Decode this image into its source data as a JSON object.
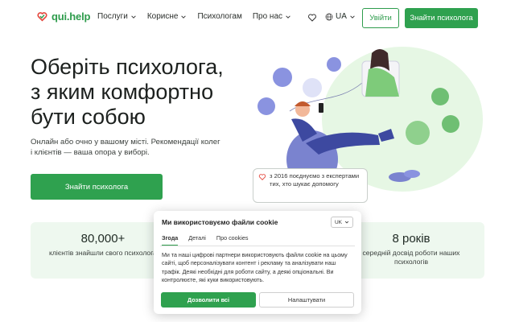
{
  "header": {
    "logo_text": "qui.help",
    "nav": [
      {
        "label": "Послуги",
        "has_dropdown": true
      },
      {
        "label": "Корисне",
        "has_dropdown": true
      },
      {
        "label": "Психологам",
        "has_dropdown": false
      },
      {
        "label": "Про нас",
        "has_dropdown": true
      }
    ],
    "language": "UA",
    "login_label": "Увійти",
    "find_label": "Знайти психолога"
  },
  "hero": {
    "title_lines": [
      "Оберіть психолога,",
      "з яким комфортно",
      "бути собою"
    ],
    "subtitle": "Онлайн або очно у вашому місті. Рекомендації колег і клієнтів — ваша опора у виборі.",
    "cta_label": "Знайти психолога",
    "quote": "з 2016 поєднуємо з експертами тих, хто шукає допомогу"
  },
  "stats": [
    {
      "value": "80,000+",
      "label": "клієнтів знайшли свого психолога"
    },
    {
      "value": "8 років",
      "label": "середній досвід роботи наших психологів"
    }
  ],
  "cookie": {
    "title": "Ми використовуємо файли cookie",
    "language": "UK",
    "tabs": [
      "Згода",
      "Деталі",
      "Про cookies"
    ],
    "active_tab": "Згода",
    "body": "Ми та наші цифрові партнери використовують файли cookie на цьому сайті, щоб персоналізувати контент і рекламу та аналізувати наш трафік. Деякі необхідні для роботи сайту, а деякі опціональні. Ви контролюєте, які куки використовують.",
    "accept_label": "Дозволити всі",
    "settings_label": "Налаштувати"
  },
  "colors": {
    "brand_green": "#2fa14f",
    "stats_bg": "#eef8ef",
    "illustration_bg": "#e6f7e4"
  },
  "icons": [
    "heart-logo-icon",
    "chevron-down-icon",
    "heart-icon",
    "globe-icon"
  ]
}
